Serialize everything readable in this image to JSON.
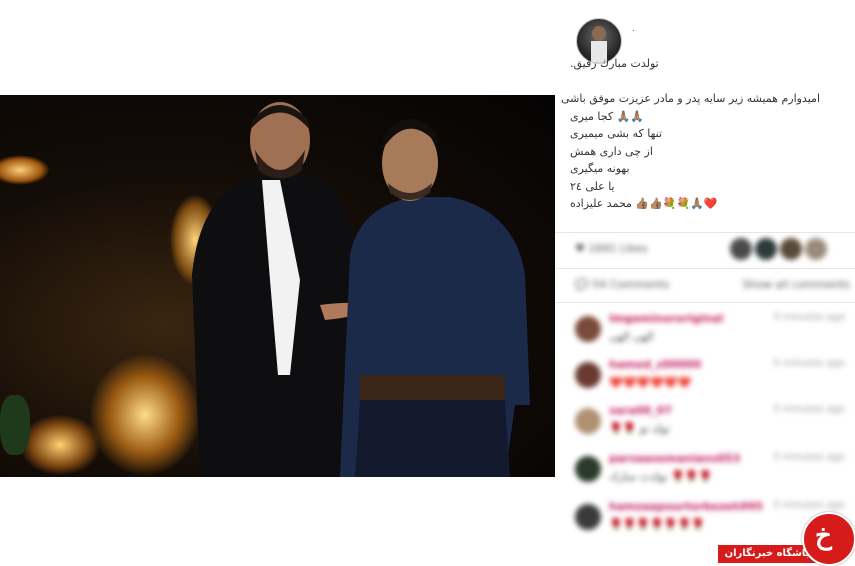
{
  "post": {
    "username": ".",
    "caption_lines": [
      "تولدت مبارك رفيق.",
      "",
      "اميدوارم هميشه زير سايه پدر و مادر عزيزت موفق باشی",
      "🙏🏽🙏🏽 كجا ميری",
      "تنها كه بشی ميميری",
      "از چی داری همش",
      "بهونه ميگيری",
      "يا علی ٢٤",
      "❤️🙏🏽💐💐👍🏽👍🏽 محمد عليزاده"
    ]
  },
  "likes_text": "♥ 1691 Likes",
  "comments": {
    "count_label": "💬 54 Comments",
    "show_all_label": "Show all comments",
    "items": [
      {
        "user": "Imgaminororiginal",
        "time": "5 minutes ago",
        "text": "الهی الهی"
      },
      {
        "user": "hamed_z00000",
        "time": "5 minutes ago",
        "text": "❤️❤️❤️❤️❤️❤️"
      },
      {
        "user": "sara00_07",
        "time": "5 minutes ago",
        "text": "🌹🌹 تولد تو"
      },
      {
        "user": "parsaasemanians053",
        "time": "5 minutes ago",
        "text": "تولدت مبارك 🌹🌹🌹"
      },
      {
        "user": "hamzaapourtorkezeh995",
        "time": "5 minutes ago",
        "text": "🌹🌹🌹🌹🌹🌹🌹"
      }
    ]
  },
  "watermark": {
    "label": "باشگاه خبرنگاران",
    "glyph": "خ"
  },
  "colors": {
    "accent": "#d71b1b",
    "username": "#c2185b"
  }
}
